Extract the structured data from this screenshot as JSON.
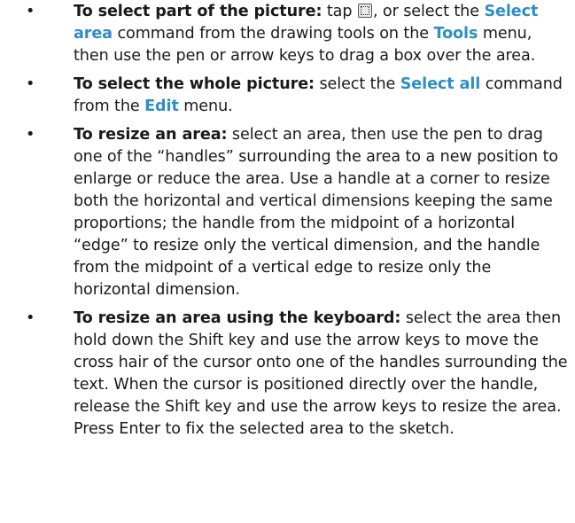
{
  "items": [
    {
      "bullet": "•",
      "lead": "To select part of the picture:",
      "t1": " tap ",
      "icon": "select-area-icon",
      "t2": ", or select the ",
      "k1": "Select area",
      "t3": " command from the drawing tools on the ",
      "k2": "Tools",
      "t4": " menu, then use the pen or arrow keys to drag a box over the area."
    },
    {
      "bullet": "•",
      "lead": "To select the whole picture:",
      "t1": " select the ",
      "k1": "Select all",
      "t2": " command from the ",
      "k2": "Edit",
      "t3": " menu."
    },
    {
      "bullet": "•",
      "lead": "To resize an area:",
      "t1": " select an area, then use the pen to drag one of the “handles” surrounding the area to a new position to enlarge or reduce the area. Use a handle at a corner to resize both the horizontal and vertical dimensions keeping the same proportions; the handle from the midpoint of a horizontal “edge” to resize only the vertical dimension, and the handle from the midpoint of a vertical edge to resize only the horizontal dimension."
    },
    {
      "bullet": "•",
      "lead": "To resize an area using the keyboard:",
      "t1": " select the area then hold down the Shift key and use the arrow keys to move the cross hair of the cursor onto one of the handles surrounding the text. When the cursor is positioned directly over the handle, release the Shift key and use the arrow keys to resize the area. Press Enter to fix the selected area to the sketch."
    }
  ],
  "colors": {
    "keyword": "#2d8fc4",
    "text": "#1a1a1a"
  }
}
